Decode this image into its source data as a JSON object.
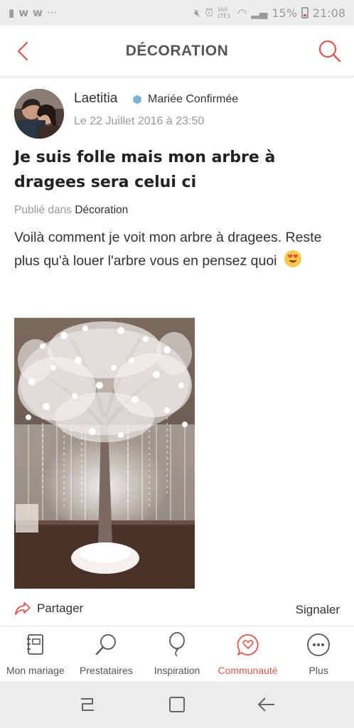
{
  "status_bar": {
    "battery": "15%",
    "time": "21:08",
    "network_label": "Voli LTE1"
  },
  "header": {
    "title": "DÉCORATION"
  },
  "post": {
    "author": "Laetitia",
    "badge": "Mariée Confirmée",
    "date": "Le 22 Juillet 2016 à 23:50",
    "title": "Je suis folle mais mon arbre à dragees sera celui ci",
    "published_prefix": "Publié dans",
    "category": "Décoration",
    "body": "Voilà comment je voit mon arbre à dragees. Reste plus qu'à louer l'arbre vous en pensez quoi"
  },
  "actions": {
    "share": "Partager",
    "report": "Signaler"
  },
  "tabs": [
    {
      "label": "Mon mariage",
      "icon": "planner-book-icon"
    },
    {
      "label": "Prestataires",
      "icon": "magnifier-icon"
    },
    {
      "label": "Inspiration",
      "icon": "balloon-icon"
    },
    {
      "label": "Communauté",
      "icon": "heart-chat-icon",
      "active": true
    },
    {
      "label": "Plus",
      "icon": "more-dots-icon"
    }
  ],
  "colors": {
    "accent": "#e2574c",
    "badge": "#7fb3d5",
    "status_bar_bg": "#ececec"
  }
}
